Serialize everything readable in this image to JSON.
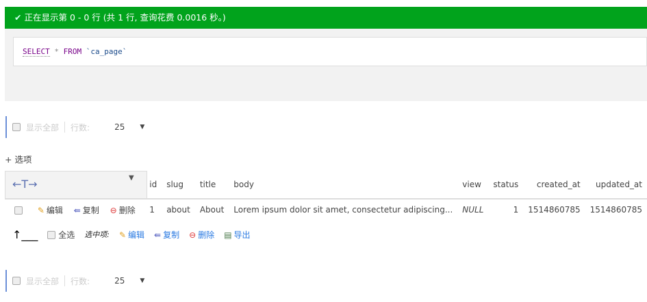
{
  "message": {
    "text": "正在显示第 0 - 0 行 (共 1 行, 查询花费 0.0016 秒。)"
  },
  "sql": {
    "select": "SELECT",
    "star": "*",
    "from": "FROM",
    "table": "`ca_page`"
  },
  "nav": {
    "show_all": "显示全部",
    "rows_label": "行数:",
    "rows_value": "25"
  },
  "options_label": "+ 选项",
  "table": {
    "headers": [
      "id",
      "slug",
      "title",
      "body",
      "view",
      "status",
      "created_at",
      "updated_at"
    ],
    "row_actions": {
      "edit": "编辑",
      "copy": "复制",
      "delete": "删除"
    },
    "rows": [
      {
        "id": "1",
        "slug": "about",
        "title": "About",
        "body": "Lorem ipsum dolor sit amet, consectetur adipiscing...",
        "view": "NULL",
        "status": "1",
        "created_at": "1514860785",
        "updated_at": "1514860785"
      }
    ]
  },
  "bulk": {
    "select_all": "全选",
    "with_selected": "选中项:",
    "edit": "编辑",
    "copy": "复制",
    "delete": "删除",
    "export": "导出"
  }
}
